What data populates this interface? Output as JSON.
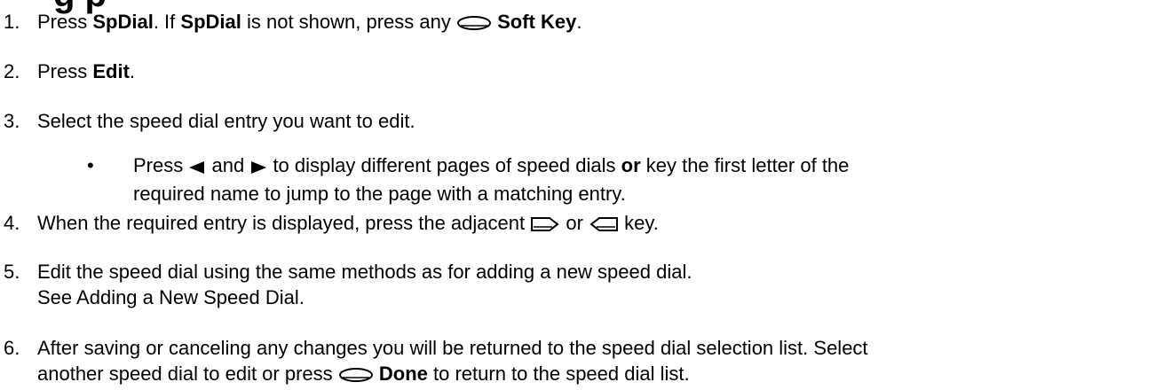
{
  "heading_fragment": "g  p",
  "steps": [
    {
      "n": "1.",
      "parts": [
        "Press ",
        "SpDial",
        ". If ",
        "SpDial",
        " is not shown, press any ",
        "Soft Key",
        "."
      ]
    },
    {
      "n": "2.",
      "parts": [
        "Press ",
        "Edit",
        "."
      ]
    },
    {
      "n": "3.",
      "parts": [
        "Select the speed dial entry you want to edit."
      ]
    },
    {
      "n": "4.",
      "parts": [
        "When the required entry is displayed, press the adjacent ",
        " or ",
        " key."
      ]
    },
    {
      "n": "5.",
      "parts": [
        "Edit the speed dial using the same methods as for adding a new speed dial.",
        "See Adding a New Speed Dial."
      ]
    },
    {
      "n": "6.",
      "parts": [
        "After saving or canceling any changes you will be returned to the speed dial selection list. Select",
        "another speed dial to edit or press ",
        "Done",
        " to return to the speed dial list."
      ]
    }
  ],
  "bullet": {
    "dot": "•",
    "parts": [
      "Press ",
      " and ",
      " to display different pages of speed dials ",
      "or",
      " key the first letter of the",
      "required name to jump to the page with a matching entry."
    ]
  },
  "icons": {
    "soft_key": "soft-key-icon",
    "left_arrow": "left-arrow-key-icon",
    "right_arrow": "right-arrow-key-icon",
    "right_line_key": "right-line-key-icon",
    "left_line_key": "left-line-key-icon"
  }
}
